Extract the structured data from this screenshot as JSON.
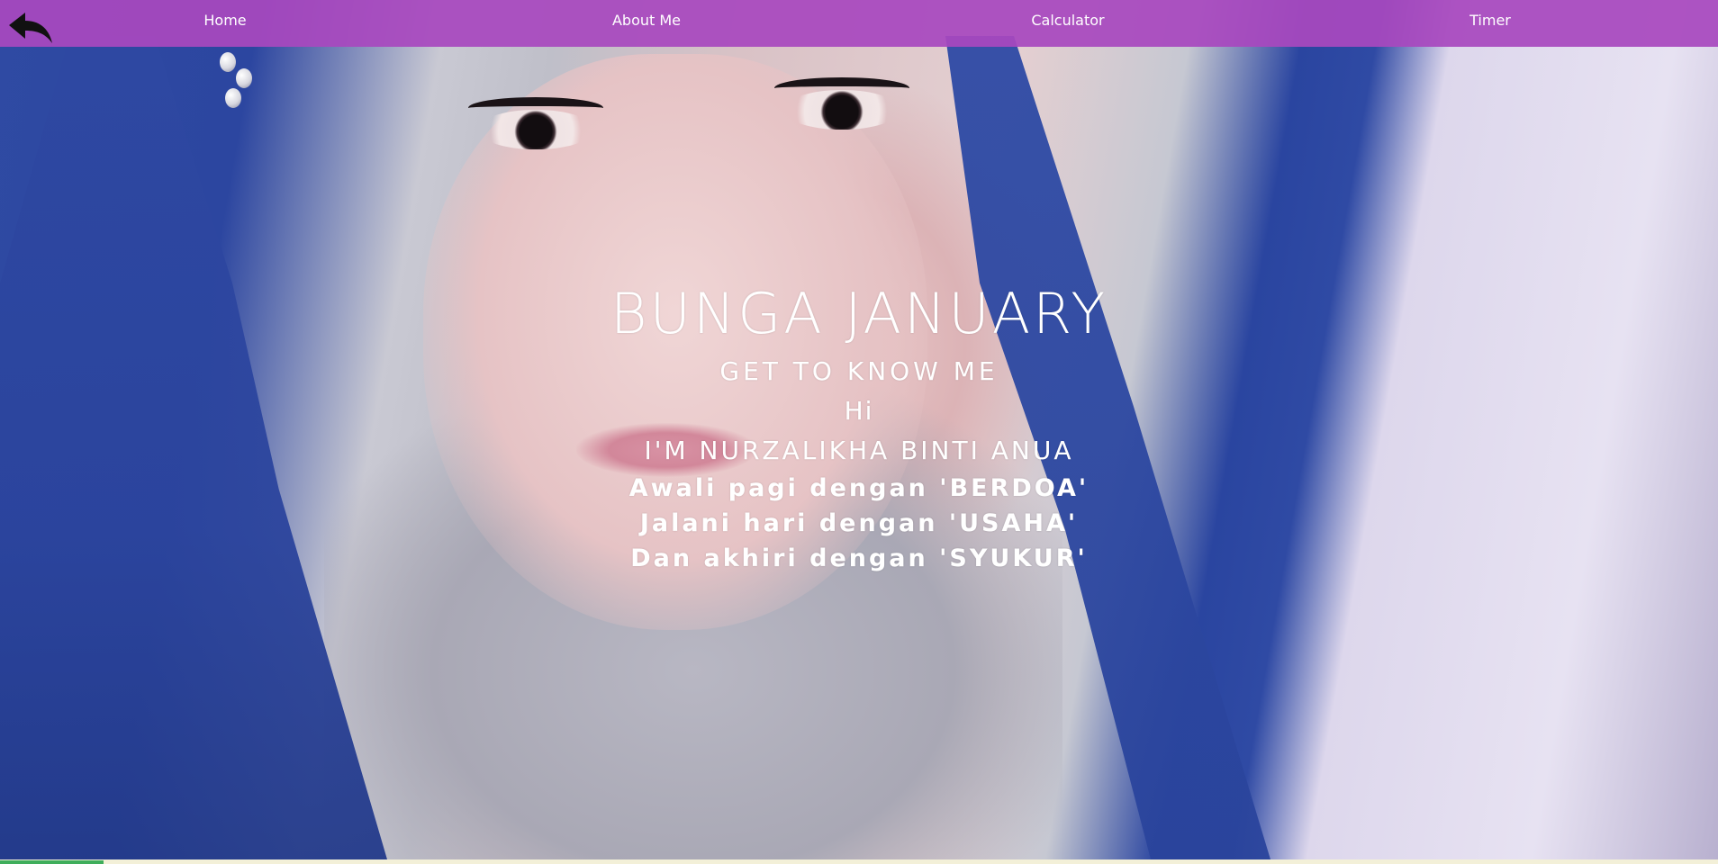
{
  "nav": {
    "back_icon": "back-arrow-icon",
    "items": [
      {
        "label": "Home"
      },
      {
        "label": "About Me"
      },
      {
        "label": "Calculator"
      },
      {
        "label": "Timer"
      }
    ]
  },
  "hero": {
    "title": "BUNGA JANUARY",
    "subtitle": "GET TO KNOW ME",
    "greeting": "Hi",
    "name_line": "I'M NURZALIKHA BINTI ANUA",
    "quotes": [
      "Awali pagi dengan 'BERDOA'",
      "Jalani hari dengan 'USAHA'",
      "Dan akhiri dengan 'SYUKUR'"
    ]
  },
  "colors": {
    "navbar": "#a848be",
    "text": "#ffffff",
    "scarf_blue": "#2e48a2"
  }
}
